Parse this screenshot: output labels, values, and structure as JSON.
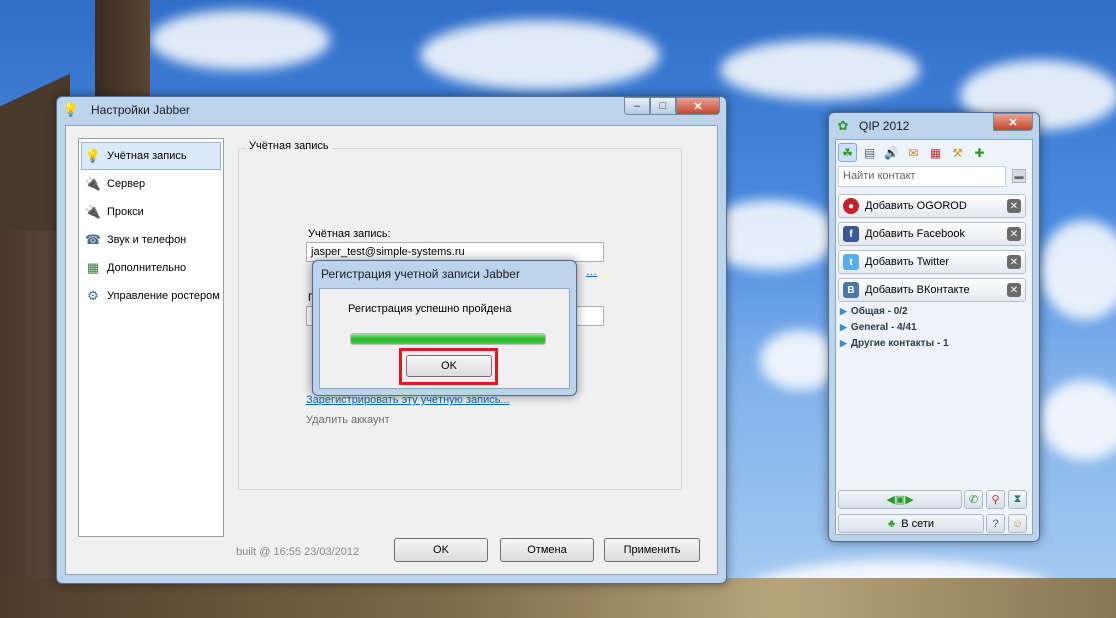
{
  "desktop": {
    "wallpaper": "sky-and-windmill"
  },
  "jabber_settings": {
    "title": "Настройки Jabber",
    "title_icon": "lightbulb-icon",
    "window_buttons": {
      "minimize": "–",
      "maximize": "□",
      "close": "✕"
    },
    "nav": [
      {
        "label": "Учётная запись",
        "icon": "lightbulb-icon",
        "selected": true
      },
      {
        "label": "Сервер",
        "icon": "plug-icon"
      },
      {
        "label": "Прокси",
        "icon": "plug-icon"
      },
      {
        "label": "Звук и телефон",
        "icon": "phone-book-icon"
      },
      {
        "label": "Дополнительно",
        "icon": "settings-window-icon"
      },
      {
        "label": "Управление ростером",
        "icon": "roster-gear-icon"
      }
    ],
    "group_title": "Учётная запись",
    "account_label": "Учётная запись:",
    "account_value": "jasper_test@simple-systems.ru",
    "partial_link": "…",
    "partial_label": "П",
    "register_link": "Зарегистрировать эту учётную запись...",
    "delete_account": "Удалить аккаунт",
    "build_info": "built @ 16:55 23/03/2012",
    "buttons": {
      "ok": "OK",
      "cancel": "Отмена",
      "apply": "Применить"
    }
  },
  "registration_dialog": {
    "title": "Регистрация учетной записи Jabber",
    "message": "Регистрация успешно пройдена",
    "progress": 1.0,
    "ok": "OK"
  },
  "qip": {
    "title": "QIP 2012",
    "title_icon": "qip-flower-icon",
    "close": "✕",
    "toolbar_icons": [
      "contacts-icon",
      "history-icon",
      "sound-icon",
      "mail-icon",
      "calendar-icon",
      "tools-icon",
      "plugins-icon"
    ],
    "search_placeholder": "Найти контакт",
    "add_buttons": [
      {
        "label": "Добавить OGOROD",
        "icon": "ogorod-icon",
        "color": "#c8202b"
      },
      {
        "label": "Добавить Facebook",
        "icon": "facebook-icon",
        "color": "#3b5998"
      },
      {
        "label": "Добавить Twitter",
        "icon": "twitter-icon",
        "color": "#55acee"
      },
      {
        "label": "Добавить ВКонтакте",
        "icon": "vkontakte-icon",
        "color": "#4a76a8"
      }
    ],
    "groups": [
      {
        "label": "Общая - 0/2"
      },
      {
        "label": "General - 4/41"
      },
      {
        "label": "Другие контакты - 1"
      }
    ],
    "status": "В сети"
  }
}
